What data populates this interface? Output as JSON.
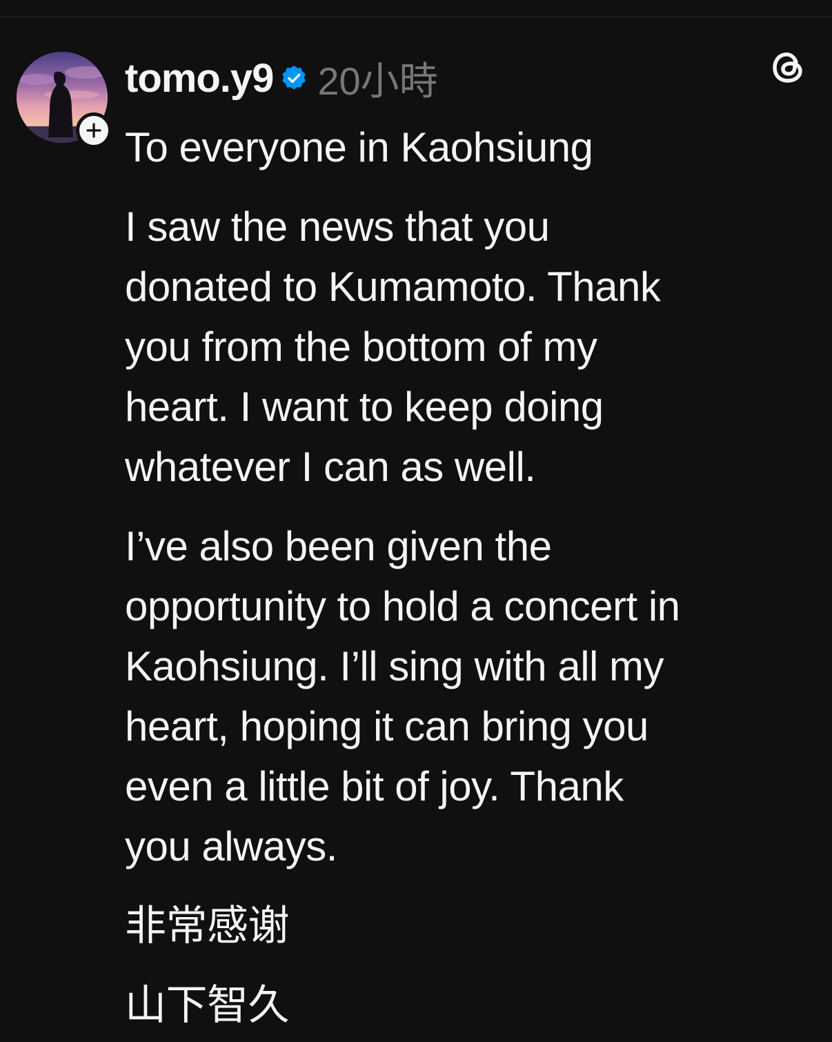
{
  "post": {
    "author": {
      "username": "tomo.y9",
      "verified": true,
      "avatar_icon": "profile-photo",
      "follow_icon": "plus-icon"
    },
    "timestamp": "20小時",
    "app_icon": "threads-logo-icon",
    "colors": {
      "background": "#101010",
      "text": "#f3f5f7",
      "muted": "#777777",
      "verified": "#0095f6"
    },
    "paragraphs": [
      {
        "lines": [
          "To everyone in Kaohsiung"
        ]
      },
      {
        "lines": [
          "I saw the news that you",
          "donated to Kumamoto. Thank",
          "you from the bottom of my",
          "heart. I want to keep doing",
          "whatever I can as well."
        ]
      },
      {
        "lines": [
          "I’ve also been given the",
          "opportunity to hold a concert in",
          "Kaohsiung. I’ll sing with all my",
          "heart, hoping it can bring you",
          "even a little bit of joy.  Thank",
          "you always."
        ]
      },
      {
        "lines": [
          "非常感谢"
        ]
      },
      {
        "lines": [
          "山下智久"
        ]
      }
    ]
  }
}
